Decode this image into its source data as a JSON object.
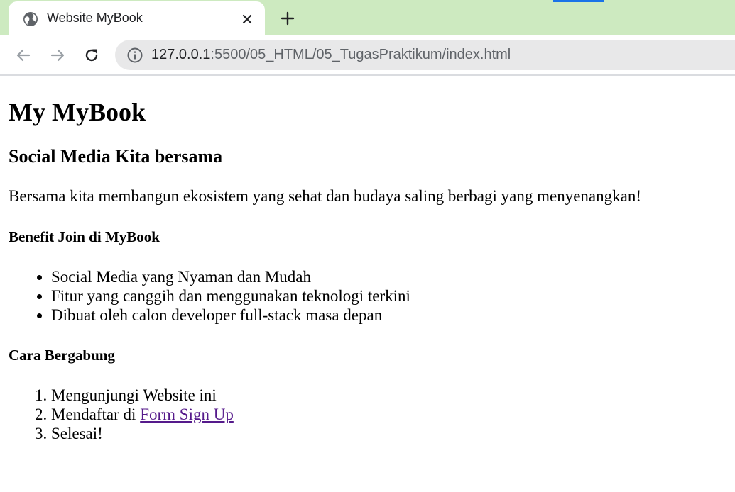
{
  "browser": {
    "tab_title": "Website MyBook",
    "url_host": "127.0.0.1",
    "url_path": ":5500/05_HTML/05_TugasPraktikum/index.html",
    "icons": {
      "favicon": "globe-icon",
      "tab_close": "close-icon",
      "new_tab": "plus-icon",
      "back": "arrow-left-icon",
      "forward": "arrow-right-icon",
      "reload": "reload-icon",
      "site_info": "info-icon"
    },
    "colors": {
      "tabstrip": "#cdeac0",
      "active_tab": "#ffffff",
      "omnibox": "#e8e8e9",
      "accent": "#1a73e8"
    }
  },
  "page": {
    "title": "My MyBook",
    "subtitle": "Social Media Kita bersama",
    "intro": "Bersama kita membangun ekosistem yang sehat dan budaya saling berbagi yang menyenangkan!",
    "benefits": {
      "heading": "Benefit Join di MyBook",
      "items": [
        "Social Media yang Nyaman dan Mudah",
        "Fitur yang canggih dan menggunakan teknologi terkini",
        "Dibuat oleh calon developer full-stack masa depan"
      ]
    },
    "join": {
      "heading": "Cara Bergabung",
      "step1": "Mengunjungi Website ini",
      "step2_prefix": "Mendaftar di ",
      "step2_link": "Form Sign Up",
      "step3": "Selesai!"
    },
    "colors": {
      "visited_link": "#551a8b"
    }
  }
}
